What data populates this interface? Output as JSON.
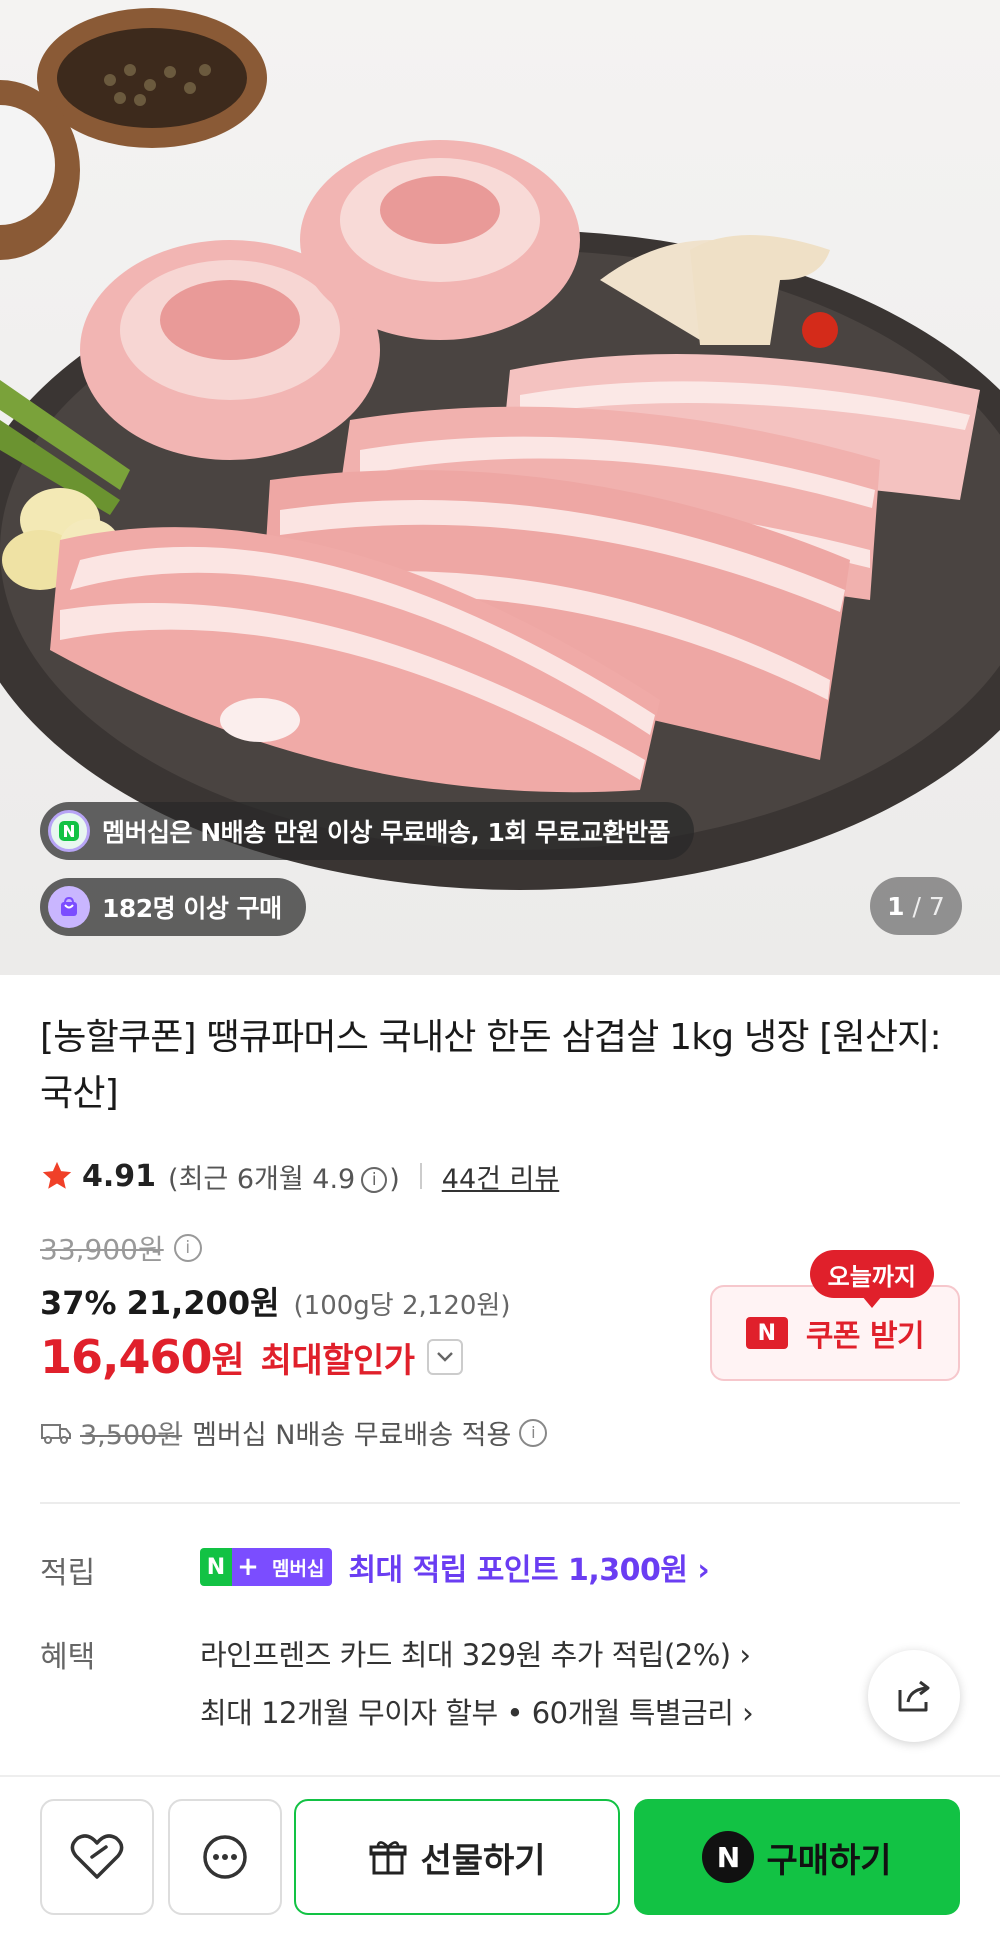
{
  "hero": {
    "membership_text": "멤버십은 N배송 만원 이상 무료배송, 1회 무료교환반품",
    "buyers_text": "182명 이상 구매",
    "counter_current": "1",
    "counter_total": "/ 7"
  },
  "product": {
    "title": "[농할쿠폰] 땡큐파머스 국내산 한돈 삼겹살 1kg 냉장 [원산지:국산]",
    "rating": "4.91",
    "recent_prefix": "(최근 6개월 4.9",
    "recent_suffix": ")",
    "reviews_link": "44건 리뷰",
    "original_price": "33,900원",
    "discount_percent": "37%",
    "sale_price": "21,200원",
    "unit_price": "(100g당 2,120원)",
    "final_price": "16,460",
    "final_price_unit": "원",
    "final_price_label": "최대할인가"
  },
  "coupon": {
    "tag": "오늘까지",
    "badge": "N",
    "label": "쿠폰 받기"
  },
  "shipping": {
    "original_fee": "3,500원",
    "text": "멤버십 N배송 무료배송 적용"
  },
  "benefits": {
    "points_label": "적립",
    "badge_n": "N",
    "badge_plus": "+",
    "badge_membership": "멤버십",
    "points_text": "최대 적립 포인트 1,300원 ›",
    "benefit_label": "혜택",
    "card_line": "라인프렌즈 카드 최대 329원 추가 적립(2%) ›",
    "installment_line": "최대 12개월 무이자 할부 • 60개월 특별금리 ›"
  },
  "bottom_bar": {
    "gift_label": "선물하기",
    "buy_badge": "N",
    "buy_label": "구매하기"
  },
  "colors": {
    "accent_red": "#e0202b",
    "naver_green": "#12c244",
    "membership_purple": "#6a3df2"
  }
}
